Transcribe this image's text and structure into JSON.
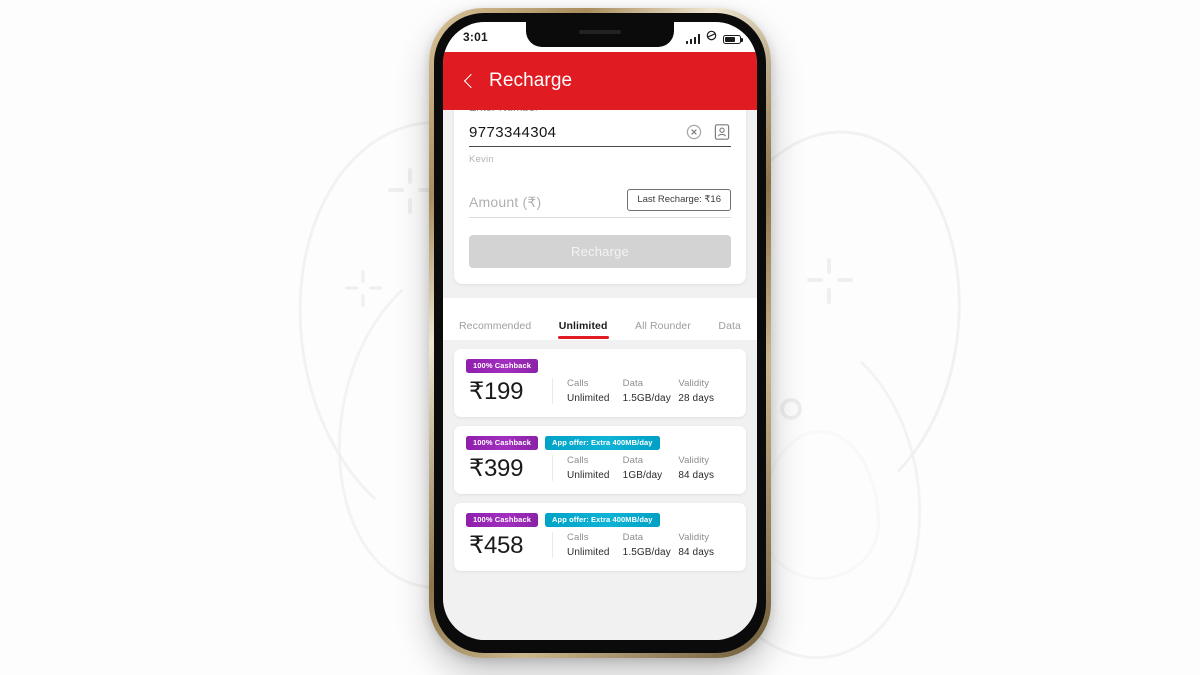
{
  "background": {
    "page_bg": "#fdfdfd",
    "deco_color": "#efefef"
  },
  "device": {
    "frame_color": "#a98d5d",
    "bezel_color": "#0b0b0b"
  },
  "status_bar": {
    "time": "3:01",
    "signal_icon": "signal-bars-icon",
    "network_icon": "network-icon",
    "battery_icon": "battery-icon"
  },
  "header": {
    "title": "Recharge",
    "back_icon": "back-chevron-icon",
    "bg_color": "#e01b22"
  },
  "recharge_form": {
    "number_label": "Enter Number",
    "number_value": "9773344304",
    "number_placeholder": "Enter Number",
    "clear_icon": "clear-circle-icon",
    "contacts_icon": "contact-card-icon",
    "contact_name": "Kevin",
    "amount_placeholder": "Amount (₹)",
    "amount_value": "",
    "last_recharge_label": "Last Recharge: ₹16",
    "submit_label": "Recharge"
  },
  "tabs": [
    {
      "label": "Recommended",
      "active": false
    },
    {
      "label": "Unlimited",
      "active": true
    },
    {
      "label": "All Rounder",
      "active": false
    },
    {
      "label": "Data",
      "active": false
    }
  ],
  "tab_accent_color": "#e01b22",
  "plans": [
    {
      "badges": [
        {
          "text": "100% Cashback",
          "type": "cashback",
          "color": "#9b27b0"
        }
      ],
      "price": "₹199",
      "specs": [
        {
          "label": "Calls",
          "value": "Unlimited"
        },
        {
          "label": "Data",
          "value": "1.5GB/day"
        },
        {
          "label": "Validity",
          "value": "28 days"
        }
      ]
    },
    {
      "badges": [
        {
          "text": "100% Cashback",
          "type": "cashback",
          "color": "#9b27b0"
        },
        {
          "text": "App offer: Extra 400MB/day",
          "type": "appoffer",
          "color": "#00a3c6"
        }
      ],
      "price": "₹399",
      "specs": [
        {
          "label": "Calls",
          "value": "Unlimited"
        },
        {
          "label": "Data",
          "value": "1GB/day"
        },
        {
          "label": "Validity",
          "value": "84 days"
        }
      ]
    },
    {
      "badges": [
        {
          "text": "100% Cashback",
          "type": "cashback",
          "color": "#9b27b0"
        },
        {
          "text": "App offer: Extra 400MB/day",
          "type": "appoffer",
          "color": "#00a3c6"
        }
      ],
      "price": "₹458",
      "specs": [
        {
          "label": "Calls",
          "value": "Unlimited"
        },
        {
          "label": "Data",
          "value": "1.5GB/day"
        },
        {
          "label": "Validity",
          "value": "84 days"
        }
      ]
    }
  ]
}
